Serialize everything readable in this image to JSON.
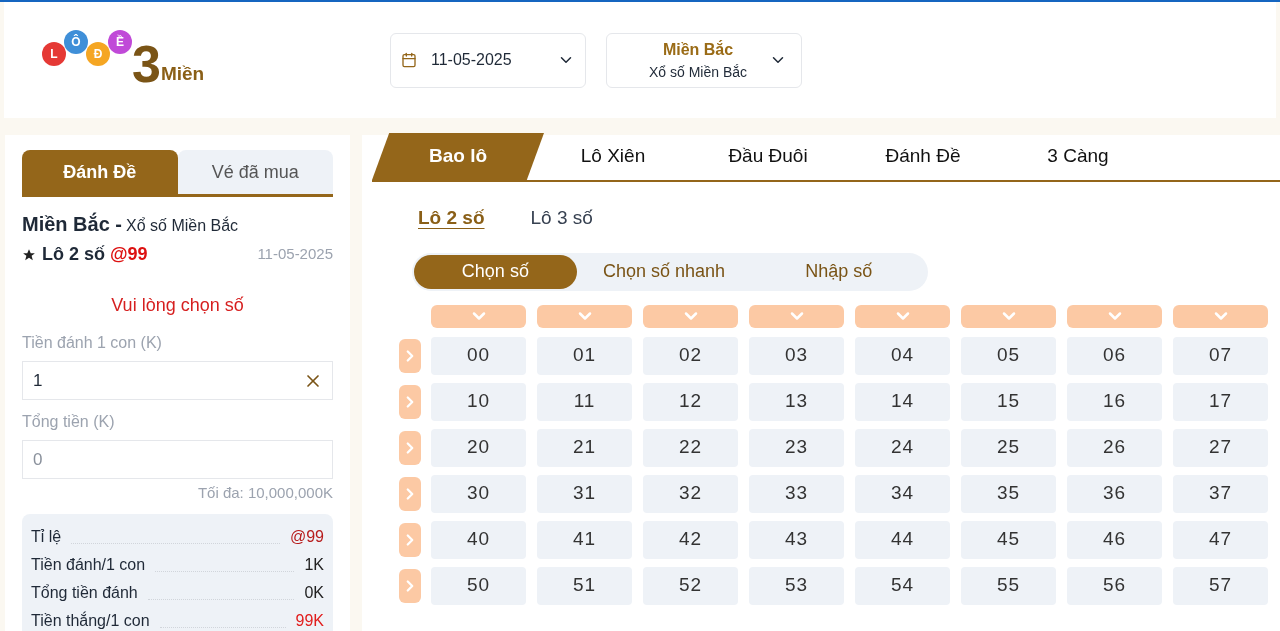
{
  "logo": {
    "balls": [
      {
        "letter": "L",
        "color": "#e53935"
      },
      {
        "letter": "Ô",
        "color": "#3f8fd8"
      },
      {
        "letter": "Đ",
        "color": "#f5a623"
      },
      {
        "letter": "Ề",
        "color": "#c04ad8"
      }
    ],
    "number": "3",
    "text": "Miền"
  },
  "date_picker": {
    "value": "11-05-2025"
  },
  "region_picker": {
    "region": "Miền Bắc",
    "lottery": "Xổ số Miền Bắc"
  },
  "side_tabs": [
    {
      "label": "Đánh Đề",
      "selected": true
    },
    {
      "label": "Vé đã mua",
      "selected": false
    }
  ],
  "ticket": {
    "region": "Miền Bắc -",
    "lottery": "Xổ số Miền Bắc",
    "bet_type": "Lô 2 số",
    "odds": "@99",
    "date": "11-05-2025",
    "warning": "Vui lòng chọn số",
    "stake_label": "Tiền đánh 1 con (K)",
    "stake_value": "1",
    "total_label": "Tổng tiền (K)",
    "total_placeholder": "0",
    "max_note": "Tối đa: 10,000,000K",
    "summary": [
      {
        "label": "Tỉ lệ",
        "value": "@99",
        "kind": "odds"
      },
      {
        "label": "Tiền đánh/1 con",
        "value": "1K",
        "kind": "plain"
      },
      {
        "label": "Tổng tiền đánh",
        "value": "0K",
        "kind": "plain"
      },
      {
        "label": "Tiền thắng/1 con",
        "value": "99K",
        "kind": "win"
      }
    ]
  },
  "game_tabs": [
    {
      "label": "Bao lô",
      "selected": true
    },
    {
      "label": "Lô Xiên",
      "selected": false
    },
    {
      "label": "Đầu Đuôi",
      "selected": false
    },
    {
      "label": "Đánh Đề",
      "selected": false
    },
    {
      "label": "3 Càng",
      "selected": false
    }
  ],
  "sub_tabs": [
    {
      "label": "Lô 2 số",
      "selected": true
    },
    {
      "label": "Lô 3 số",
      "selected": false
    }
  ],
  "modes": [
    {
      "label": "Chọn số",
      "selected": true
    },
    {
      "label": "Chọn số nhanh",
      "selected": false
    },
    {
      "label": "Nhập số",
      "selected": false
    }
  ],
  "grid": [
    [
      {
        "label": "00",
        "selected": false
      },
      {
        "label": "01",
        "selected": false
      },
      {
        "label": "02",
        "selected": false
      },
      {
        "label": "03",
        "selected": false
      },
      {
        "label": "04",
        "selected": false
      },
      {
        "label": "05",
        "selected": false
      },
      {
        "label": "06",
        "selected": false
      },
      {
        "label": "07",
        "selected": false
      }
    ],
    [
      {
        "label": "10",
        "selected": false
      },
      {
        "label": "11",
        "selected": false
      },
      {
        "label": "12",
        "selected": false
      },
      {
        "label": "13",
        "selected": false
      },
      {
        "label": "14",
        "selected": false
      },
      {
        "label": "15",
        "selected": false
      },
      {
        "label": "16",
        "selected": false
      },
      {
        "label": "17",
        "selected": false
      }
    ],
    [
      {
        "label": "20",
        "selected": false
      },
      {
        "label": "21",
        "selected": false
      },
      {
        "label": "22",
        "selected": false
      },
      {
        "label": "23",
        "selected": false
      },
      {
        "label": "24",
        "selected": false
      },
      {
        "label": "25",
        "selected": false
      },
      {
        "label": "26",
        "selected": false
      },
      {
        "label": "27",
        "selected": false
      }
    ],
    [
      {
        "label": "30",
        "selected": false
      },
      {
        "label": "31",
        "selected": false
      },
      {
        "label": "32",
        "selected": false
      },
      {
        "label": "33",
        "selected": false
      },
      {
        "label": "34",
        "selected": false
      },
      {
        "label": "35",
        "selected": false
      },
      {
        "label": "36",
        "selected": false
      },
      {
        "label": "37",
        "selected": false
      }
    ],
    [
      {
        "label": "40",
        "selected": false
      },
      {
        "label": "41",
        "selected": false
      },
      {
        "label": "42",
        "selected": false
      },
      {
        "label": "43",
        "selected": false
      },
      {
        "label": "44",
        "selected": false
      },
      {
        "label": "45",
        "selected": false
      },
      {
        "label": "46",
        "selected": false
      },
      {
        "label": "47",
        "selected": false
      }
    ],
    [
      {
        "label": "50",
        "selected": false
      },
      {
        "label": "51",
        "selected": false
      },
      {
        "label": "52",
        "selected": false
      },
      {
        "label": "53",
        "selected": false
      },
      {
        "label": "54",
        "selected": false
      },
      {
        "label": "55",
        "selected": false
      },
      {
        "label": "56",
        "selected": false
      },
      {
        "label": "57",
        "selected": false
      }
    ]
  ]
}
